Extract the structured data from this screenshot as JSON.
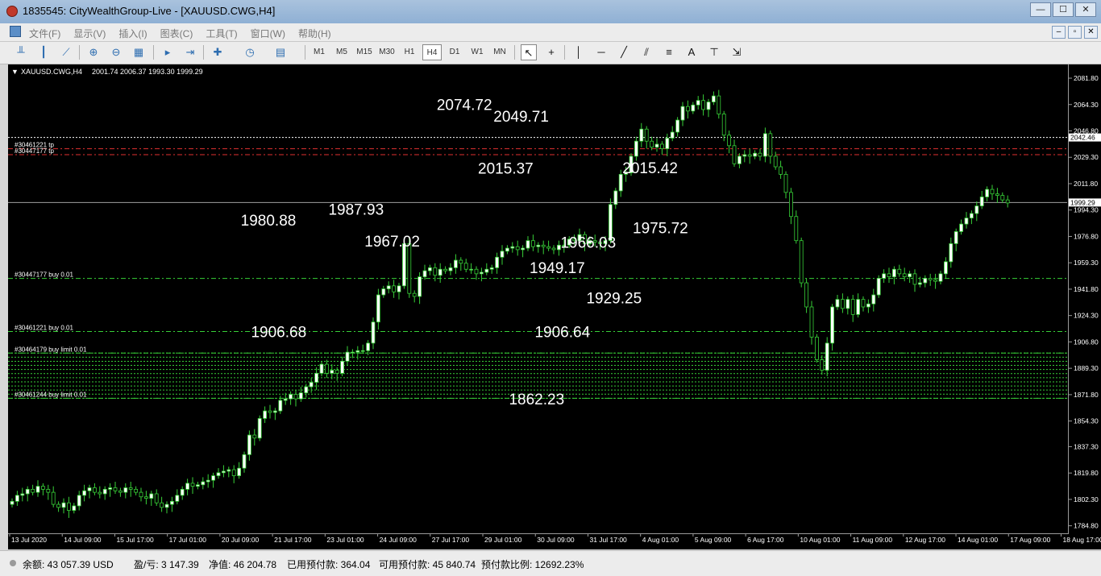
{
  "window": {
    "title": "1835545: CityWealthGroup-Live - [XAUUSD.CWG,H4]",
    "controls": [
      "—",
      "☐",
      "✕"
    ]
  },
  "menu": {
    "items": [
      "文件(F)",
      "显示(V)",
      "插入(I)",
      "图表(C)",
      "工具(T)",
      "窗口(W)",
      "帮助(H)"
    ],
    "child_controls": [
      "–",
      "▫",
      "✕"
    ]
  },
  "toolbar": {
    "timeframes": [
      "M1",
      "M5",
      "M15",
      "M30",
      "H1",
      "H4",
      "D1",
      "W1",
      "MN"
    ],
    "active_timeframe": "H4",
    "text_tool": "A"
  },
  "chart_header": {
    "symbol": "XAUUSD.CWG,H4",
    "ohlc": "2001.74 2006.37 1993.30 1999.29"
  },
  "chart_data": {
    "type": "candlestick",
    "symbol": "XAUUSD.CWG",
    "timeframe": "H4",
    "ylim": [
      1779.8,
      2090.9
    ],
    "y_ticks": [
      "2081.80",
      "2064.30",
      "2046.80",
      "2029.30",
      "2011.80",
      "1994.30",
      "1976.80",
      "1959.30",
      "1941.80",
      "1924.30",
      "1906.80",
      "1889.30",
      "1871.80",
      "1854.30",
      "1837.30",
      "1819.80",
      "1802.30",
      "1784.80"
    ],
    "x_ticks": [
      "13 Jul 2020",
      "14 Jul 09:00",
      "15 Jul 17:00",
      "17 Jul 01:00",
      "20 Jul 09:00",
      "21 Jul 17:00",
      "23 Jul 01:00",
      "24 Jul 09:00",
      "27 Jul 17:00",
      "29 Jul 01:00",
      "30 Jul 09:00",
      "31 Jul 17:00",
      "4 Aug 01:00",
      "5 Aug 09:00",
      "6 Aug 17:00",
      "10 Aug 01:00",
      "11 Aug 09:00",
      "12 Aug 17:00",
      "14 Aug 01:00",
      "17 Aug 09:00",
      "18 Aug 17:00"
    ],
    "current_price": "1999.29",
    "price_tag": "2042.46",
    "price_annotations": [
      {
        "label": "2074.72",
        "price": 2074.72,
        "bar": 88
      },
      {
        "label": "2049.71",
        "price": 2049.71,
        "bar": 99
      },
      {
        "label": "2015.37",
        "price": 2015.37,
        "bar": 96
      },
      {
        "label": "1980.88",
        "price": 1980.88,
        "bar": 50
      },
      {
        "label": "1906.68",
        "price": 1906.68,
        "bar": 52
      },
      {
        "label": "1987.93",
        "price": 1987.93,
        "bar": 67
      },
      {
        "label": "1967.02",
        "price": 1967.02,
        "bar": 74
      },
      {
        "label": "1966.03",
        "price": 1966.03,
        "bar": 112
      },
      {
        "label": "1949.17",
        "price": 1949.17,
        "bar": 106
      },
      {
        "label": "1906.64",
        "price": 1906.64,
        "bar": 107
      },
      {
        "label": "1862.23",
        "price": 1862.23,
        "bar": 102
      },
      {
        "label": "1929.25",
        "price": 1929.25,
        "bar": 117
      },
      {
        "label": "2015.42",
        "price": 2015.42,
        "bar": 124
      },
      {
        "label": "1975.72",
        "price": 1975.72,
        "bar": 126
      }
    ],
    "order_lines": [
      {
        "label": "#30461221 tp",
        "price": 2035.0,
        "color": "#e03030"
      },
      {
        "label": "#30447177 tp",
        "price": 2031.0,
        "color": "#e03030"
      },
      {
        "label": "#30447177 buy 0.01",
        "price": 1948.9,
        "color": "#37d037"
      },
      {
        "label": "#30461221 buy 0.01",
        "price": 1913.7,
        "color": "#37d037"
      },
      {
        "label": "#30464179 buy limit 0.01",
        "price": 1899.4,
        "color": "#37d037"
      },
      {
        "label": "#30461244 buy limit 0.01",
        "price": 1869.4,
        "color": "#37d037"
      }
    ],
    "limit_stack": {
      "top": 1899.4,
      "bottom": 1869.4,
      "count": 12
    },
    "closes": [
      1801,
      1805,
      1806,
      1809,
      1807,
      1811,
      1809,
      1807,
      1799,
      1797,
      1800,
      1795,
      1798,
      1805,
      1808,
      1810,
      1807,
      1806,
      1809,
      1810,
      1808,
      1807,
      1810,
      1809,
      1807,
      1804,
      1803,
      1806,
      1800,
      1797,
      1799,
      1801,
      1805,
      1809,
      1813,
      1811,
      1812,
      1814,
      1815,
      1818,
      1820,
      1821,
      1822,
      1818,
      1823,
      1832,
      1845,
      1843,
      1856,
      1861,
      1860,
      1861,
      1868,
      1869,
      1872,
      1869,
      1873,
      1877,
      1880,
      1886,
      1892,
      1886,
      1888,
      1886,
      1894,
      1900,
      1900,
      1901,
      1901,
      1906,
      1920,
      1938,
      1942,
      1944,
      1940,
      1944,
      1972,
      1939,
      1937,
      1950,
      1954,
      1956,
      1951,
      1955,
      1954,
      1956,
      1961,
      1959,
      1955,
      1955,
      1952,
      1953,
      1955,
      1956,
      1963,
      1967,
      1969,
      1970,
      1968,
      1969,
      1974,
      1970,
      1971,
      1970,
      1969,
      1968,
      1971,
      1971,
      1975,
      1974,
      1978,
      1972,
      1974,
      1973,
      1972,
      1974,
      1998,
      2007,
      2018,
      2019,
      2030,
      2040,
      2048,
      2040,
      2036,
      2038,
      2035,
      2042,
      2046,
      2054,
      2063,
      2060,
      2064,
      2067,
      2061,
      2066,
      2070,
      2058,
      2044,
      2037,
      2025,
      2030,
      2031,
      2030,
      2032,
      2030,
      2045,
      2030,
      2023,
      2018,
      2006,
      1990,
      1974,
      1946,
      1930,
      1910,
      1895,
      1888,
      1906,
      1930,
      1935,
      1929,
      1935,
      1925,
      1935,
      1930,
      1932,
      1938,
      1949,
      1952,
      1950,
      1955,
      1952,
      1950,
      1952,
      1945,
      1946,
      1949,
      1948,
      1947,
      1952,
      1960,
      1972,
      1980,
      1985,
      1989,
      1992,
      1997,
      2003,
      2008,
      2005,
      2004,
      2001,
      1999
    ]
  },
  "status": {
    "balance": "余额: 43 057.39 USD",
    "profit": "盈/亏: 3 147.39",
    "equity": "净值: 46 204.78",
    "margin": "已用预付款: 364.04",
    "free_margin": "可用预付款: 45 840.74",
    "margin_level": "预付款比例: 12692.23%"
  },
  "colors": {
    "chart_bg": "#000000",
    "candle_bull": "#ffffff",
    "candle_bear": "#000000",
    "candle_outline": "#37d037",
    "axis_text": "#ffffff",
    "tp_line": "#e03030",
    "buy_line": "#37d037"
  }
}
